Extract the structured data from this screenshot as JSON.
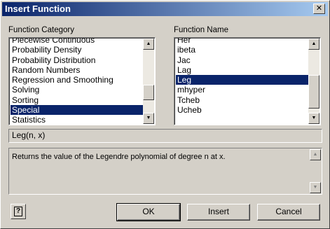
{
  "window": {
    "title": "Insert Function",
    "close_glyph": "✕"
  },
  "category": {
    "label": "Function Category",
    "items": [
      "Piecewise Continuous",
      "Probability Density",
      "Probability Distribution",
      "Random Numbers",
      "Regression and Smoothing",
      "Solving",
      "Sorting",
      "Special",
      "Statistics"
    ],
    "selected": "Special"
  },
  "function_name": {
    "label": "Function Name",
    "items": [
      "Her",
      "ibeta",
      "Jac",
      "Lag",
      "Leg",
      "mhyper",
      "Tcheb",
      "Ucheb"
    ],
    "selected": "Leg"
  },
  "syntax": "Leg(n, x)",
  "description": "Returns the value of the Legendre polynomial of degree n at x.",
  "buttons": {
    "ok": "OK",
    "insert": "Insert",
    "cancel": "Cancel"
  },
  "icons": {
    "help": "help-icon",
    "scroll_up": "▲",
    "scroll_down": "▼"
  }
}
